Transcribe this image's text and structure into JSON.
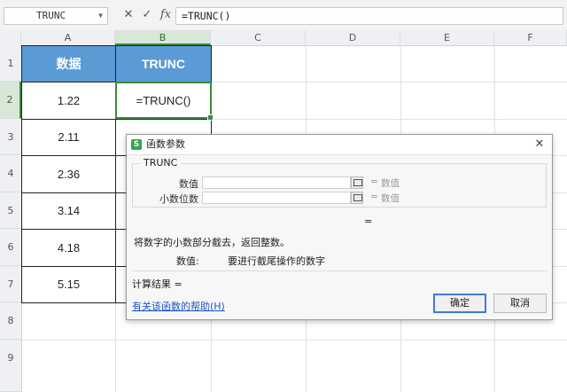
{
  "formula_bar": {
    "name_box": "TRUNC",
    "cancel_glyph": "✕",
    "enter_glyph": "✓",
    "fx_label": "fx",
    "formula": "=TRUNC()"
  },
  "columns": [
    "A",
    "B",
    "C",
    "D",
    "E",
    "F"
  ],
  "rows": [
    "1",
    "2",
    "3",
    "4",
    "5",
    "6",
    "7",
    "8",
    "9"
  ],
  "table": {
    "header_a": "数据",
    "header_b": "TRUNC",
    "values": [
      "1.22",
      "2.11",
      "2.36",
      "3.14",
      "4.18",
      "5.15"
    ],
    "active_cell_text": "=TRUNC()"
  },
  "colors": {
    "header_fill": "#5b9bd5",
    "selection_green": "#3b8a3b",
    "link_blue": "#1a56c8"
  },
  "dialog": {
    "title": "函数参数",
    "close_glyph": "✕",
    "group_title": "TRUNC",
    "args": [
      {
        "label": "数值",
        "eq": "=",
        "result": "数值"
      },
      {
        "label": "小数位数",
        "eq": "=",
        "result": "数值"
      }
    ],
    "result_eq": "=",
    "description": "将数字的小数部分截去，返回整数。",
    "param_name": "数值:",
    "param_desc": "要进行截尾操作的数字",
    "calc_result": "计算结果 =",
    "help_link": "有关该函数的帮助(H)",
    "ok_label": "确定",
    "cancel_label": "取消"
  }
}
